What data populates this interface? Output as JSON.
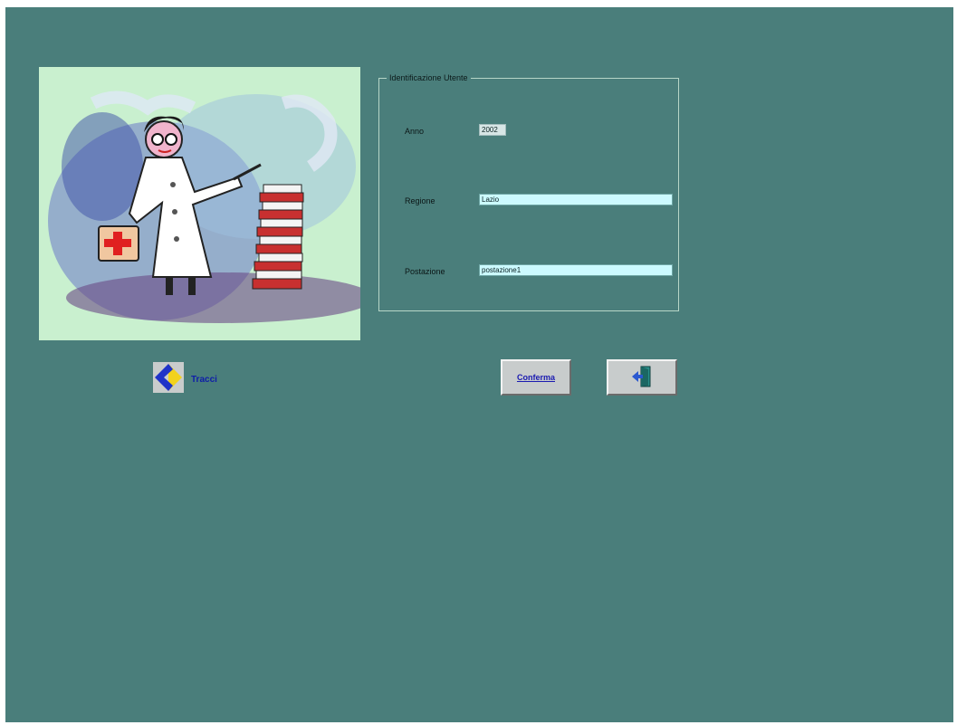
{
  "form": {
    "legend": "Identificazione Utente",
    "fields": [
      {
        "label": "Anno",
        "value": "2002"
      },
      {
        "label": "Regione",
        "value": "Lazio"
      },
      {
        "label": "Postazione",
        "value": "postazione1"
      }
    ]
  },
  "nav": {
    "back_label": "Tracci",
    "back_icon": "arrow-left-icon"
  },
  "buttons": {
    "confirm_label": "Conferma",
    "exit_icon": "exit-door-icon"
  },
  "colors": {
    "background": "#4a7e7b",
    "input_bg": "#ccfaff",
    "button_face": "#c8cccc",
    "illustration_bg": "#c9f0cf"
  }
}
